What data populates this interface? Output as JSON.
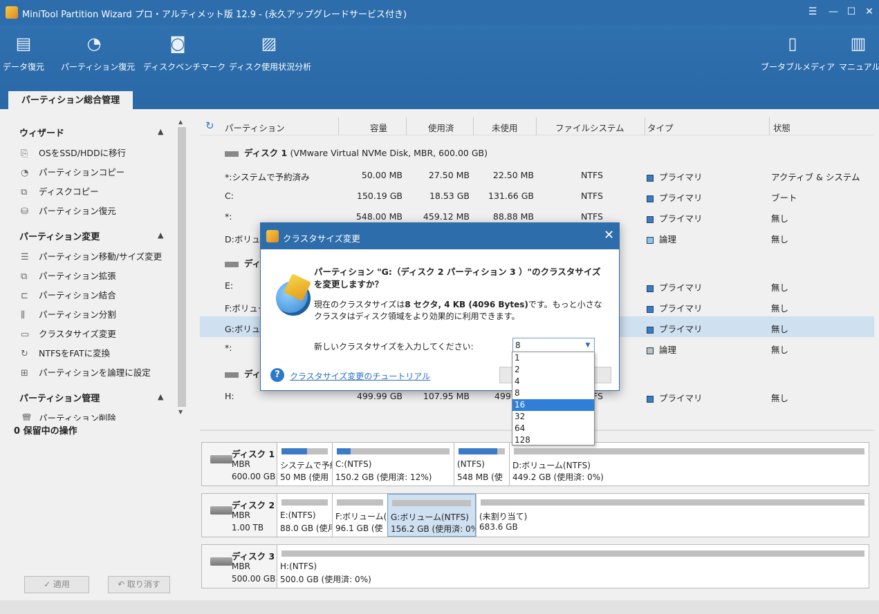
{
  "window": {
    "title": "MiniTool Partition Wizard プロ・アルティメット版 12.9 - (永久アップグレードサービス付き)"
  },
  "toolbar": {
    "left": [
      {
        "label": "データ復元",
        "icon": "data-recovery-icon"
      },
      {
        "label": "パーティション復元",
        "icon": "partition-recovery-icon"
      },
      {
        "label": "ディスクベンチマーク",
        "icon": "disk-benchmark-icon"
      },
      {
        "label": "ディスク使用状況分析",
        "icon": "space-analyzer-icon"
      }
    ],
    "right": [
      {
        "label": "ブータブルメディア",
        "icon": "bootable-media-icon"
      },
      {
        "label": "マニュアル",
        "icon": "manual-icon"
      }
    ]
  },
  "main_tab": "パーティション総合管理",
  "sidebar": {
    "sections": [
      {
        "title": "ウィザード",
        "items": [
          "OSをSSD/HDDに移行",
          "パーティションコピー",
          "ディスクコピー",
          "パーティション復元"
        ]
      },
      {
        "title": "パーティション変更",
        "items": [
          "パーティション移動/サイズ変更",
          "パーティション拡張",
          "パーティション結合",
          "パーティション分割",
          "クラスタサイズ変更",
          "NTFSをFATに変換",
          "パーティションを論理に設定"
        ]
      },
      {
        "title": "パーティション管理",
        "items": [
          "パーティション削除"
        ]
      }
    ],
    "pending": "0 保留中の操作",
    "apply": "✓ 適用",
    "undo": "↶ 取り消す"
  },
  "grid": {
    "headers": [
      "パーティション",
      "容量",
      "使用済",
      "未使用",
      "ファイルシステム",
      "タイプ",
      "状態"
    ],
    "disk1": {
      "name": "ディスク 1",
      "desc": "(VMware Virtual NVMe Disk, MBR, 600.00 GB)"
    },
    "disk2": {
      "name": "ディ"
    },
    "disk3": {
      "name": "ディ"
    },
    "rows": [
      {
        "name": "*:システムで予約済み",
        "cap": "50.00 MB",
        "used": "27.50 MB",
        "unused": "22.50 MB",
        "fs": "NTFS",
        "type": "プライマリ",
        "status": "アクティブ & システム"
      },
      {
        "name": "C:",
        "cap": "150.19 GB",
        "used": "18.53 GB",
        "unused": "131.66 GB",
        "fs": "NTFS",
        "type": "プライマリ",
        "status": "ブート"
      },
      {
        "name": "*:",
        "cap": "548.00 MB",
        "used": "459.12 MB",
        "unused": "88.88 MB",
        "fs": "NTFS",
        "type": "プライマリ",
        "status": "無し"
      },
      {
        "name": "D:ボリュー",
        "cap": "",
        "used": "",
        "unused": "",
        "fs": "",
        "type": "論理",
        "status": "無し"
      },
      {
        "name": "E:",
        "cap": "",
        "used": "",
        "unused": "",
        "fs": "",
        "type": "プライマリ",
        "status": "無し"
      },
      {
        "name": "F:ボリューム",
        "cap": "",
        "used": "",
        "unused": "",
        "fs": "",
        "type": "プライマリ",
        "status": "無し"
      },
      {
        "name": "G:ボリュー",
        "cap": "",
        "used": "",
        "unused": "",
        "fs": "",
        "type": "プライマリ",
        "status": "無し"
      },
      {
        "name": "*:",
        "cap": "",
        "used": "",
        "unused": "",
        "fs": "",
        "type": "論理",
        "status": "無し"
      },
      {
        "name": "H:",
        "cap": "499.99 GB",
        "used": "107.95 MB",
        "unused": "499.",
        "fs": "FS",
        "type": "プライマリ",
        "status": "無し"
      }
    ]
  },
  "diskmap": [
    {
      "name": "ディスク 1",
      "kind": "MBR",
      "size": "600.00 GB",
      "parts": [
        {
          "n": "システムで予約",
          "s": "50 MB (使用",
          "used": 0.55
        },
        {
          "n": "C:(NTFS)",
          "s": "150.2 GB (使用済: 12%)",
          "used": 0.12
        },
        {
          "n": "(NTFS)",
          "s": "548 MB (使",
          "used": 0.84
        },
        {
          "n": "D:ボリューム(NTFS)",
          "s": "449.2 GB (使用済: 0%)",
          "used": 0.0
        }
      ]
    },
    {
      "name": "ディスク 2",
      "kind": "MBR",
      "size": "1.00 TB",
      "parts": [
        {
          "n": "E:(NTFS)",
          "s": "88.0 GB (使月",
          "used": 0.0
        },
        {
          "n": "F:ボリューム(N",
          "s": "96.1 GB (使",
          "used": 0.0
        },
        {
          "n": "G:ボリューム(NTFS)",
          "s": "156.2 GB (使用済: 0%",
          "used": 0.0
        },
        {
          "n": "(未割り当て)",
          "s": "683.6 GB",
          "used": 0.0
        }
      ]
    },
    {
      "name": "ディスク 3",
      "kind": "MBR",
      "size": "500.00 GB",
      "parts": [
        {
          "n": "H:(NTFS)",
          "s": "500.0 GB (使用済: 0%)",
          "used": 0.0
        }
      ]
    }
  ],
  "dialog": {
    "title": "クラスタサイズ変更",
    "question": "パーティション \"G:（ディスク 2 パーティション 3 ）\"のクラスタサイズを変更しますか？",
    "info_pre": "現在のクラスタサイズは",
    "info_bold": "8 セクタ, 4 KB (4096 Bytes)",
    "info_post": "です。もっと小さなクラスタはディスク領域をより効果的に利用できます。",
    "prompt": "新しいクラスタサイズを入力してください:",
    "value": "8",
    "options": [
      "1",
      "2",
      "4",
      "8",
      "16",
      "32",
      "64",
      "128"
    ],
    "highlighted": "16",
    "help_link": "クラスタサイズ変更のチュートリアル"
  }
}
